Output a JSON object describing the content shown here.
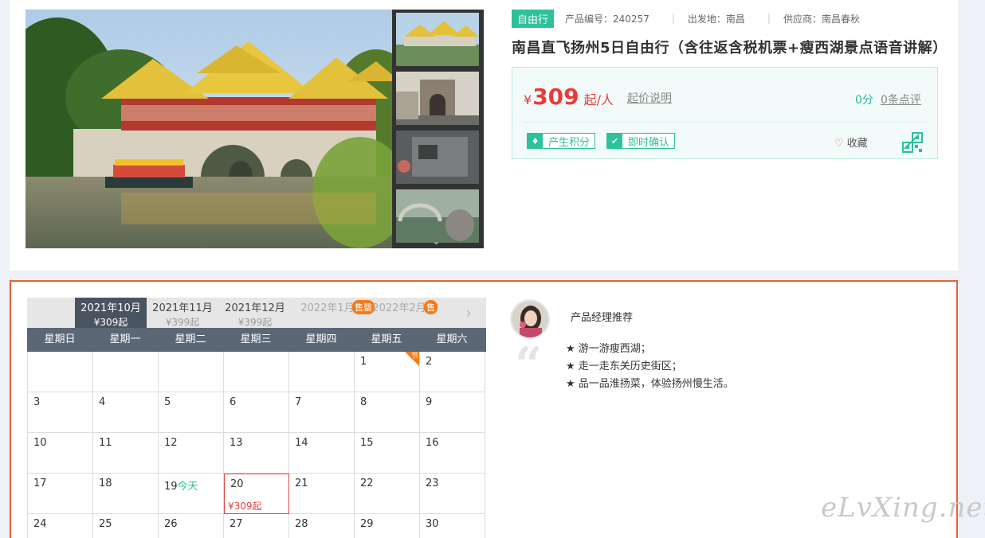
{
  "product": {
    "type_tag": "自由行",
    "product_no": "产品编号：240257",
    "departure": "出发地：南昌",
    "supplier": "供应商：南昌春秋",
    "title": "南昌直飞扬州5日自由行（含往返含税机票+瘦西湖景点语音讲解）",
    "price_symbol": "¥",
    "price": "309",
    "price_unit": "起/人",
    "price_explain": "起价说明",
    "score": "0分",
    "reviews": "0条点评",
    "badge_points": "产生积分",
    "badge_confirm": "即时确认",
    "favorite": "收藏"
  },
  "calendar": {
    "months": [
      {
        "name": "2021年10月",
        "price": "¥309起"
      },
      {
        "name": "2021年11月",
        "price": "¥399起"
      },
      {
        "name": "2021年12月",
        "price": "¥399起"
      },
      {
        "name": "2022年1月",
        "sold_out": "售罄"
      },
      {
        "name": "2022年2月",
        "sold_out": "售"
      }
    ],
    "weekdays": [
      "星期日",
      "星期一",
      "星期二",
      "星期三",
      "星期四",
      "星期五",
      "星期六"
    ],
    "holiday_mark": "节",
    "today_label": "今天",
    "selected_price": "¥309起",
    "day_numbers": [
      "1",
      "2",
      "3",
      "4",
      "5",
      "6",
      "7",
      "8",
      "9",
      "10",
      "11",
      "12",
      "13",
      "14",
      "15",
      "16",
      "17",
      "18",
      "19",
      "20",
      "21",
      "22",
      "23",
      "24",
      "25",
      "26",
      "27",
      "28",
      "29",
      "30"
    ]
  },
  "manager": {
    "title": "产品经理推荐",
    "items": [
      "游一游瘦西湖；",
      "走一走东关历史街区；",
      "品一品淮扬菜，体验扬州慢生活。"
    ]
  },
  "watermark": "eLvXing.net",
  "colors": {
    "accent_green": "#2cc29a",
    "price_red": "#e73c3c",
    "border_orange": "#e8603c",
    "sold_out_orange": "#f27b1c"
  }
}
